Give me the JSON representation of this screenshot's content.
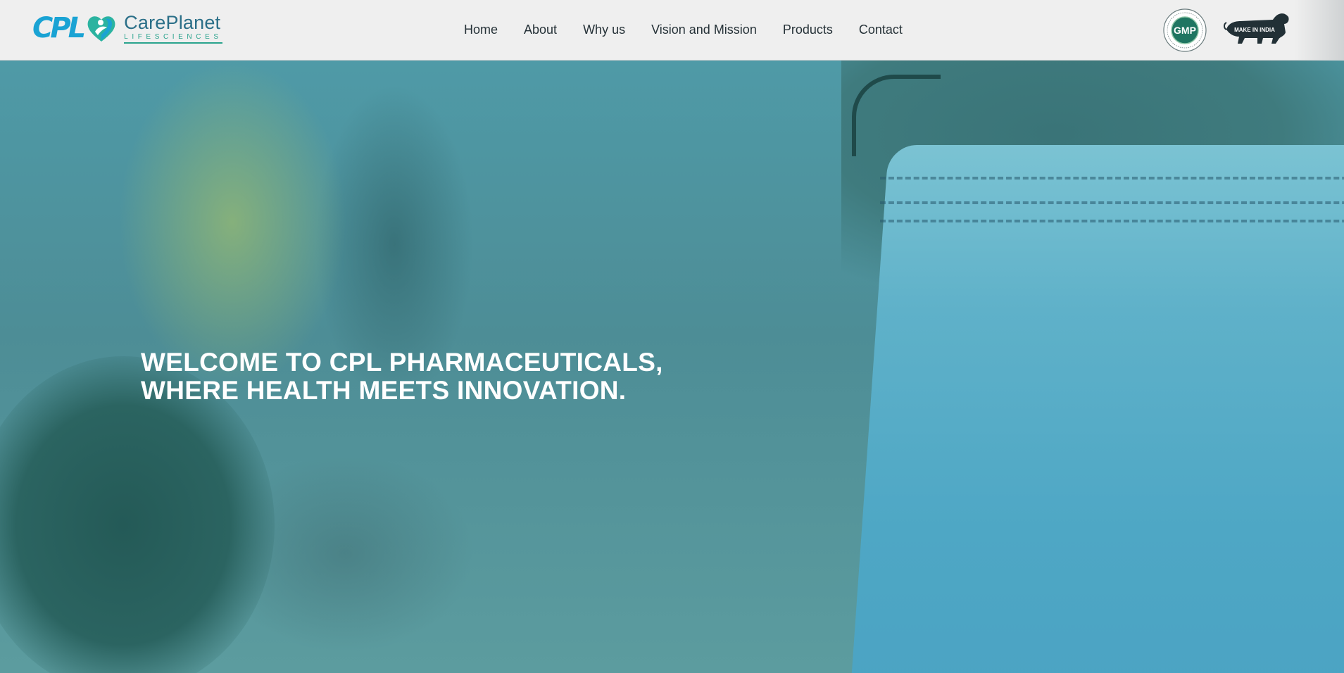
{
  "header": {
    "logo": {
      "mark": "CPL",
      "name": "CarePlanet",
      "subtitle": "LIFESCIENCES"
    },
    "nav": [
      {
        "label": "Home"
      },
      {
        "label": "About"
      },
      {
        "label": "Why us"
      },
      {
        "label": "Vision and Mission"
      },
      {
        "label": "Products"
      },
      {
        "label": "Contact"
      }
    ],
    "badges": {
      "gmp": {
        "label": "GMP",
        "ring_text": "GOOD MANUFACTURING PRACTICE PRODUCT"
      },
      "make_in_india": {
        "label": "MAKE IN INDIA"
      }
    }
  },
  "hero": {
    "headline": "WELCOME TO CPL PHARMACEUTICALS, WHERE HEALTH MEETS INNOVATION."
  },
  "colors": {
    "header_bg": "#efefef",
    "brand_blue": "#1aa3d4",
    "brand_teal": "#2aa38d",
    "nav_text": "#263238",
    "hero_overlay": "#4f8d97",
    "headline": "#ffffff"
  }
}
